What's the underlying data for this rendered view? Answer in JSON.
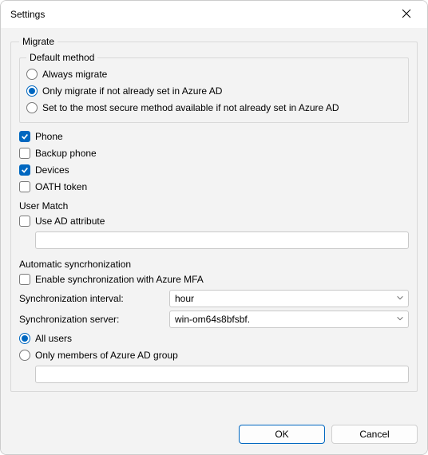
{
  "window": {
    "title": "Settings",
    "close_icon": "close-icon"
  },
  "migrate": {
    "legend": "Migrate",
    "default_method": {
      "legend": "Default method",
      "options": [
        {
          "label": "Always migrate",
          "checked": false
        },
        {
          "label": "Only migrate if not already set in Azure AD",
          "checked": true
        },
        {
          "label": "Set to the most secure method available if not already set in Azure AD",
          "checked": false
        }
      ]
    },
    "items": [
      {
        "label": "Phone",
        "checked": true
      },
      {
        "label": "Backup phone",
        "checked": false
      },
      {
        "label": "Devices",
        "checked": true
      },
      {
        "label": "OATH token",
        "checked": false
      }
    ],
    "user_match": {
      "heading": "User Match",
      "use_ad_attribute": {
        "label": "Use AD attribute",
        "checked": false
      },
      "attribute_value": ""
    },
    "auto_sync": {
      "heading": "Automatic syncrhonization",
      "enable": {
        "label": "Enable synchronization with Azure MFA",
        "checked": false
      },
      "interval_label": "Synchronization interval:",
      "interval_value": "hour",
      "server_label": "Synchronization server:",
      "server_value": "win-om64s8bfsbf.",
      "scope": [
        {
          "label": "All users",
          "checked": true
        },
        {
          "label": "Only members of Azure AD group",
          "checked": false
        }
      ],
      "group_value": ""
    }
  },
  "footer": {
    "ok": "OK",
    "cancel": "Cancel"
  },
  "colors": {
    "accent": "#0067c0",
    "panel": "#f3f3f3",
    "border": "#d9d9d9"
  }
}
